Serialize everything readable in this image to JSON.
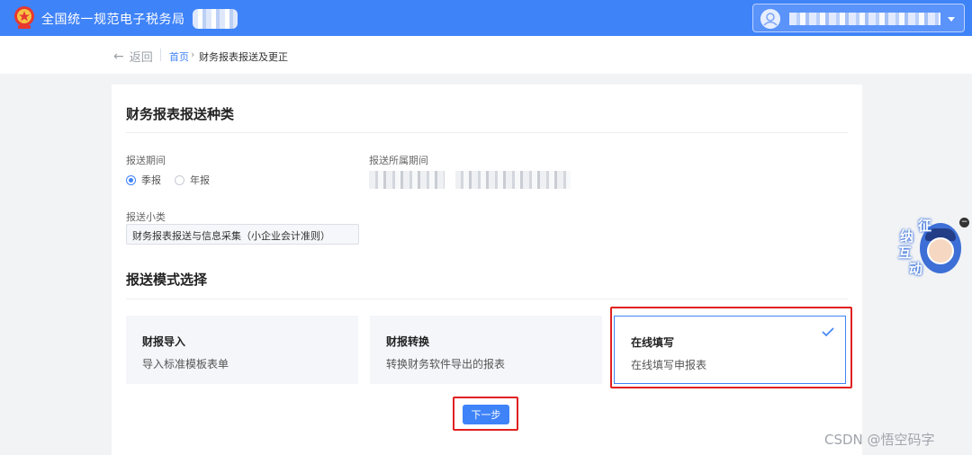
{
  "header": {
    "app_title": "全国统一规范电子税务局"
  },
  "breadcrumb": {
    "back_label": "返回",
    "home": "首页",
    "current": "财务报表报送及更正"
  },
  "report_type": {
    "section_title": "财务报表报送种类",
    "period_label": "报送期间",
    "period_options": [
      "季报",
      "年报"
    ],
    "period_selected": "季报",
    "belong_period_label": "报送所属期间",
    "subcategory_label": "报送小类",
    "subcategory_value": "财务报表报送与信息采集（小企业会计准则）"
  },
  "mode": {
    "section_title": "报送模式选择",
    "options": [
      {
        "title": "财报导入",
        "desc": "导入标准模板表单",
        "selected": false
      },
      {
        "title": "财报转换",
        "desc": "转换财务软件导出的报表",
        "selected": false
      },
      {
        "title": "在线填写",
        "desc": "在线填写申报表",
        "selected": true
      }
    ]
  },
  "actions": {
    "next_label": "下一步"
  },
  "helper": {
    "chars": [
      "征",
      "纳",
      "互",
      "动"
    ]
  },
  "watermark": "CSDN @悟空码字",
  "colors": {
    "primary": "#3f83f8",
    "highlight_box": "#e02020"
  }
}
